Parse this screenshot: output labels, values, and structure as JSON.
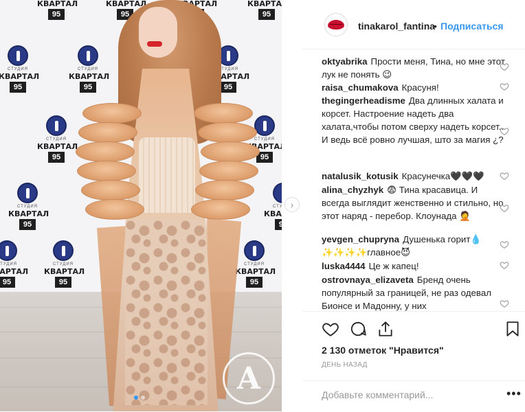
{
  "header": {
    "username": "tinakarol_fantina",
    "separator": "•",
    "follow_label": "Подписаться"
  },
  "backdrop_logos": {
    "studio": "СТУДИЯ",
    "brand": "КВАРТАЛ",
    "number": "95"
  },
  "photo": {
    "watermark_letter": "A",
    "carousel_count": 2,
    "carousel_active": 1,
    "next_arrow": "›"
  },
  "comments": [
    {
      "user": "oktyabrika",
      "text": "Прости меня, Тина, но мне этот лук не понять 😉"
    },
    {
      "user": "raisa_chumakova",
      "text": "Красуня!"
    },
    {
      "user": "thegingerheadisme",
      "text": "Два длинных халата и корсет. Настроение надеть два халата,чтобы потом сверху надеть корсет.. И ведь всё ровно лучшая, што за магия ¿?"
    },
    {
      "user": "natalusik_kotusik",
      "text": "Красунечка🖤🖤🖤"
    },
    {
      "user": "alina_chyzhyk",
      "text": "😨 Тина красавица. И всегда выглядит женственно и стильно, но этот наряд - перебор. Клоунада 🤦"
    },
    {
      "user": "yevgen_chupryna",
      "text": "Душенька горит💧 ✨✨✨✨главное😈"
    },
    {
      "user": "luska4444",
      "text": "Це ж капец!"
    },
    {
      "user": "ostrovnaya_elizaveta",
      "text": "Бренд очень популярный за границей, не раз одевал Бионсе и Мадонну, у них"
    }
  ],
  "actions": {
    "likes_label": "2 130 отметок \"Нравится\"",
    "date_label": "ДЕНЬ НАЗАД"
  },
  "add_comment": {
    "placeholder": "Добавьте комментарий...",
    "more_label": "•••"
  },
  "colors": {
    "accent": "#3897f0",
    "text": "#262626",
    "muted": "#999999",
    "brand_lips": "#c8102e"
  }
}
